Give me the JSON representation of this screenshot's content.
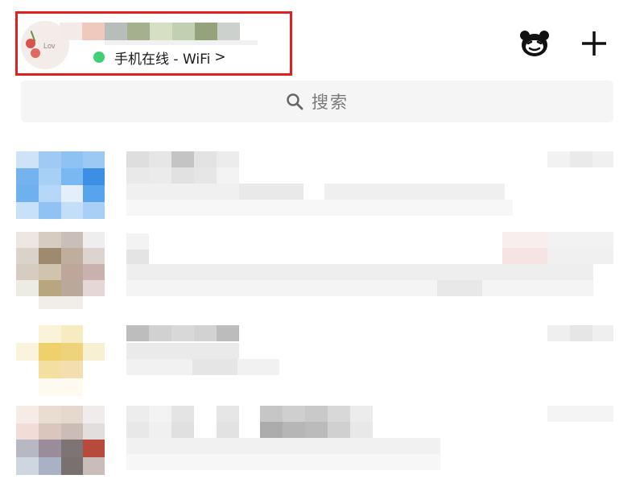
{
  "header": {
    "status_text": "手机在线 - WiFi",
    "status_chevron": ">",
    "status_color": "#3fcf74",
    "highlight_color": "#e01f1f",
    "icons": [
      "bear-face-icon",
      "plus-icon"
    ]
  },
  "search": {
    "label": "搜索",
    "icon": "search-icon"
  },
  "chat_list": {
    "items": [
      {
        "obscured": true
      },
      {
        "obscured": true
      },
      {
        "obscured": true
      },
      {
        "obscured": true
      }
    ]
  }
}
